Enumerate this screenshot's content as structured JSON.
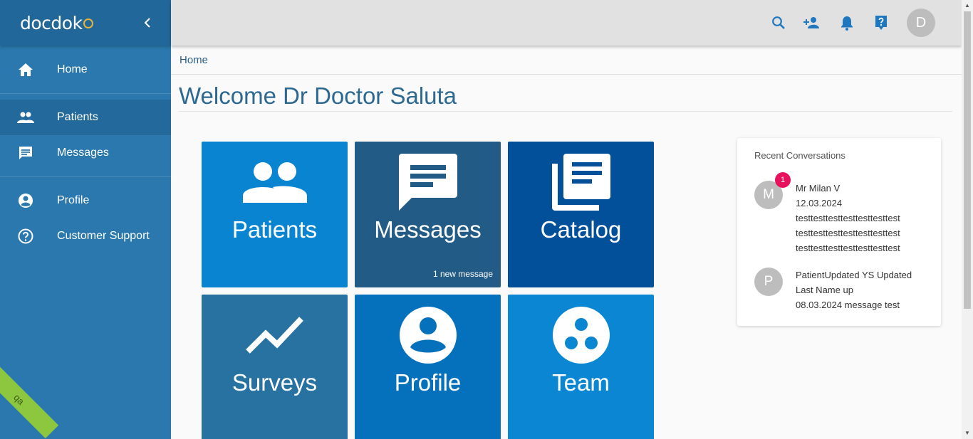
{
  "app": {
    "logo_text": "docdok"
  },
  "sidebar": {
    "items": [
      {
        "label": "Home",
        "icon": "home-icon"
      },
      {
        "label": "Patients",
        "icon": "people-icon",
        "active": true
      },
      {
        "label": "Messages",
        "icon": "message-icon"
      },
      {
        "label": "Profile",
        "icon": "account-circle-icon"
      },
      {
        "label": "Customer Support",
        "icon": "help-circle-icon"
      }
    ],
    "env_ribbon": "qa"
  },
  "topbar": {
    "icons": [
      "search-icon",
      "add-person-icon",
      "bell-icon",
      "help-icon"
    ],
    "avatar_initial": "D"
  },
  "breadcrumb": "Home",
  "page_title": "Welcome Dr Doctor Saluta",
  "tiles": [
    {
      "label": "Patients",
      "icon": "people-icon",
      "color": "#0984d0"
    },
    {
      "label": "Messages",
      "icon": "message-icon",
      "color": "#225c86",
      "note": "1 new message"
    },
    {
      "label": "Catalog",
      "icon": "library-books-icon",
      "color": "#025099"
    },
    {
      "label": "Surveys",
      "icon": "trending-icon",
      "color": "#2872a2"
    },
    {
      "label": "Profile",
      "icon": "account-circle-icon",
      "color": "#0570bc"
    },
    {
      "label": "Team",
      "icon": "team-icon",
      "color": "#0b86d2"
    }
  ],
  "recent": {
    "title": "Recent Conversations",
    "items": [
      {
        "initial": "M",
        "badge": "1",
        "name": "Mr Milan V",
        "date": "12.03.2024",
        "lines": [
          "testtesttesttesttesttesttest",
          "testtesttesttesttesttesttest",
          "testtesttesttesttesttesttest"
        ]
      },
      {
        "initial": "P",
        "name": "PatientUpdated YS Updated",
        "lines": [
          "Last Name up",
          "08.03.2024 message test"
        ]
      }
    ]
  }
}
